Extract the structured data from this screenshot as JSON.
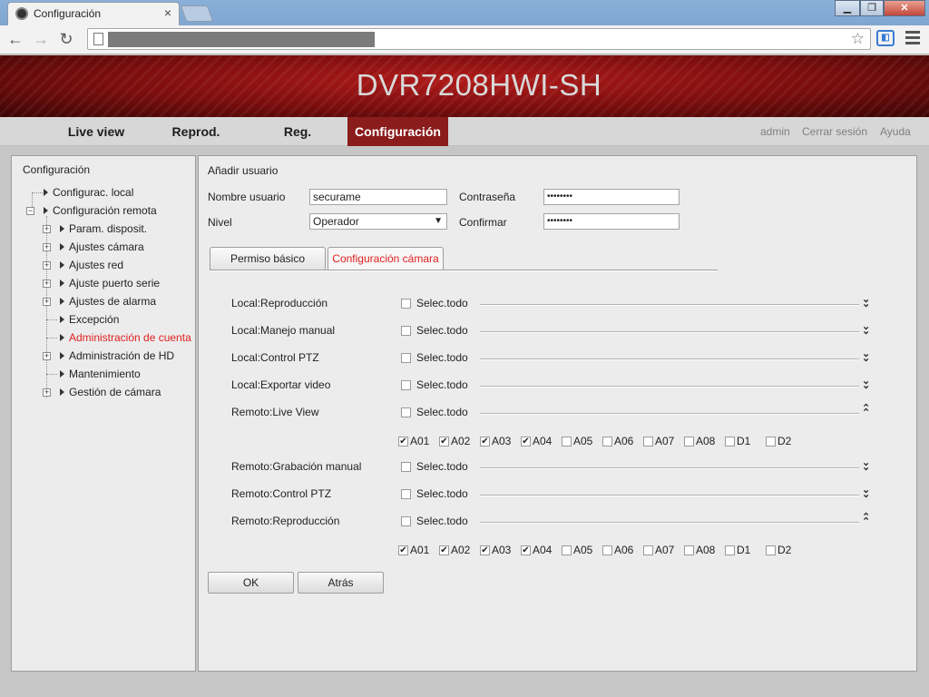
{
  "browser": {
    "tab_title": "Configuración",
    "tab_close": "×",
    "window_controls": {
      "minimize": "▁",
      "maximize": "❐",
      "close": "✕"
    },
    "nav": {
      "back": "←",
      "forward": "→",
      "reload": "↻"
    },
    "star": "☆",
    "ext": "◧"
  },
  "header": {
    "model": "DVR7208HWI-SH",
    "nav": [
      "Live view",
      "Reprod.",
      "Reg.",
      "Configuración"
    ],
    "active_nav": "Configuración",
    "util": {
      "user": "admin",
      "logout": "Cerrar sesión",
      "help": "Ayuda"
    }
  },
  "sidebar": {
    "title": "Configuración",
    "items": [
      {
        "label": "Configurac. local"
      },
      {
        "label": "Configuración remota"
      },
      {
        "label": "Param. disposit."
      },
      {
        "label": "Ajustes cámara"
      },
      {
        "label": "Ajustes red"
      },
      {
        "label": "Ajuste puerto serie"
      },
      {
        "label": "Ajustes de alarma"
      },
      {
        "label": "Excepción"
      },
      {
        "label": "Administración de cuenta"
      },
      {
        "label": "Administración de HD"
      },
      {
        "label": "Mantenimiento"
      },
      {
        "label": "Gestión de cámara"
      }
    ]
  },
  "form": {
    "section_title": "Añadir usuario",
    "username_label": "Nombre usuario",
    "username_value": "securame",
    "password_label": "Contraseña",
    "password_value": "••••••••",
    "level_label": "Nivel",
    "level_value": "Operador",
    "confirm_label": "Confirmar",
    "confirm_value": "••••••••"
  },
  "tabs": {
    "basic": "Permiso básico",
    "camera": "Configuración cámara"
  },
  "select_all_label": "Selec.todo",
  "permissions": [
    {
      "label": "Local:Reproducción",
      "expanded": false
    },
    {
      "label": "Local:Manejo manual",
      "expanded": false
    },
    {
      "label": "Local:Control PTZ",
      "expanded": false
    },
    {
      "label": "Local:Exportar video",
      "expanded": false
    },
    {
      "label": "Remoto:Live View",
      "expanded": true
    },
    {
      "label": "Remoto:Grabación manual",
      "expanded": false
    },
    {
      "label": "Remoto:Control PTZ",
      "expanded": false
    },
    {
      "label": "Remoto:Reproducción",
      "expanded": true
    }
  ],
  "channels": {
    "labels": [
      "A01",
      "A02",
      "A03",
      "A04",
      "A05",
      "A06",
      "A07",
      "A08",
      "D1",
      "D2"
    ],
    "live_view_checked": [
      true,
      true,
      true,
      true,
      false,
      false,
      false,
      false,
      false,
      false
    ],
    "playback_checked": [
      true,
      true,
      true,
      true,
      false,
      false,
      false,
      false,
      false,
      false
    ]
  },
  "buttons": {
    "ok": "OK",
    "back": "Atrás"
  },
  "icons": {
    "expand_down": "double-chevron-down-icon",
    "collapse_up": "double-chevron-up-icon",
    "check": "✔"
  },
  "colors": {
    "banner_red": "#8b1c1c",
    "active_link": "#e02020"
  }
}
